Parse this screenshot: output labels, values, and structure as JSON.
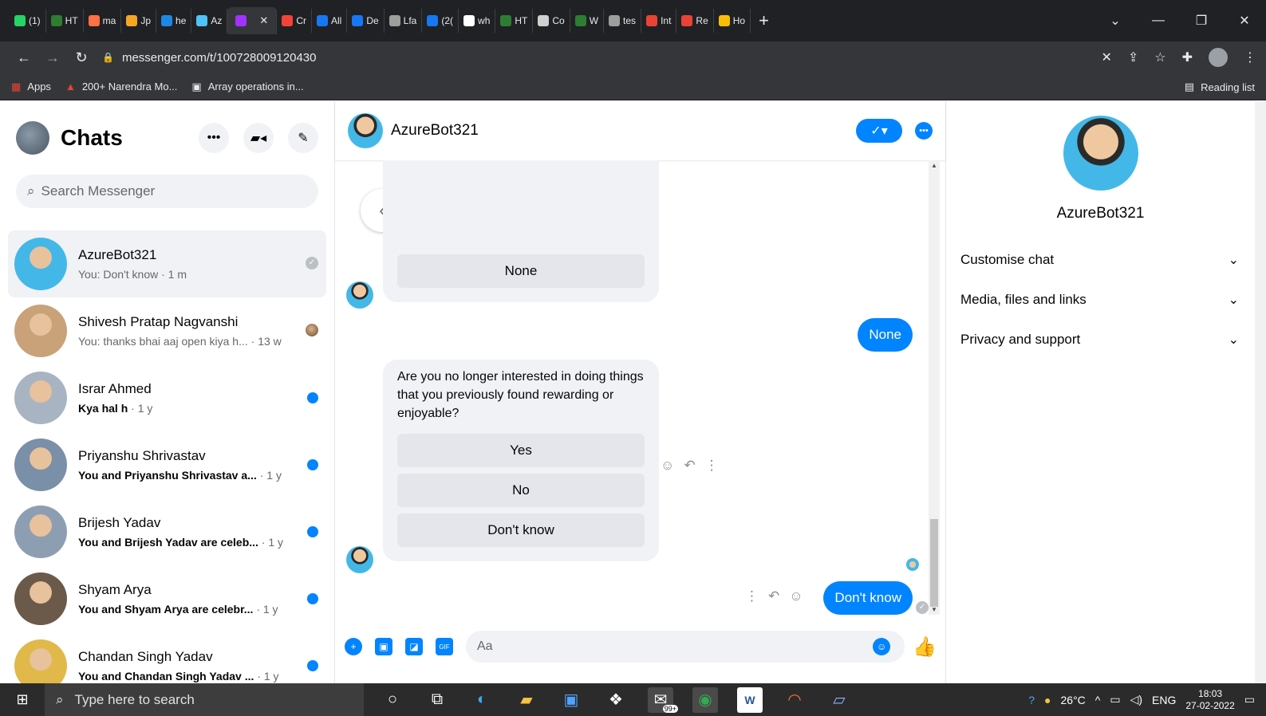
{
  "browser": {
    "tabs": [
      {
        "label": "(1)",
        "color": "#25d366"
      },
      {
        "label": "HT",
        "color": "#2e7d32"
      },
      {
        "label": "ma",
        "color": "#ff7043"
      },
      {
        "label": "Jp",
        "color": "#f5a623"
      },
      {
        "label": "he",
        "color": "#1e88e5"
      },
      {
        "label": "Az",
        "color": "#4fc3f7"
      },
      {
        "label": "",
        "color": "#a033ff",
        "active": true
      },
      {
        "label": "Cr",
        "color": "#f44336"
      },
      {
        "label": "All",
        "color": "#1877f2"
      },
      {
        "label": "De",
        "color": "#1877f2"
      },
      {
        "label": "Lfa",
        "color": "#9e9e9e"
      },
      {
        "label": "(2(",
        "color": "#1877f2"
      },
      {
        "label": "wh",
        "color": "#ffffff"
      },
      {
        "label": "HT",
        "color": "#2e7d32"
      },
      {
        "label": "Co",
        "color": "#cfcfcf"
      },
      {
        "label": "W",
        "color": "#2e7d32"
      },
      {
        "label": "tes",
        "color": "#9e9e9e"
      },
      {
        "label": "Int",
        "color": "#ea4335"
      },
      {
        "label": "Re",
        "color": "#ea4335"
      },
      {
        "label": "Ho",
        "color": "#fbbc04"
      }
    ],
    "new_tab": "+",
    "url": "messenger.com/t/100728009120430",
    "bookmarks": [
      {
        "label": "Apps",
        "icon": "apps-grid-icon"
      },
      {
        "label": "200+ Narendra Mo...",
        "icon": "bookmark-icon"
      },
      {
        "label": "Array operations in...",
        "icon": "bookmark-icon"
      }
    ],
    "reading_list": "Reading list"
  },
  "sidebar": {
    "title": "Chats",
    "search_placeholder": "Search Messenger",
    "chats": [
      {
        "name": "AzureBot321",
        "preview": "You: Don't know",
        "age": " · 1 m",
        "unread": false,
        "status": "seen",
        "avatar_color": "#43b8e8"
      },
      {
        "name": "Shivesh Pratap Nagvanshi",
        "preview": "You: thanks bhai aaj open kiya h...",
        "age": " · 13 w",
        "unread": false,
        "status": "avatar",
        "avatar_color": "#c9a27a"
      },
      {
        "name": "Israr Ahmed",
        "preview": "Kya hal h",
        "age": " · 1 y",
        "unread": true,
        "status": "dot",
        "avatar_color": "#a8b4c2"
      },
      {
        "name": "Priyanshu Shrivastav",
        "preview": "You and Priyanshu Shrivastav a...",
        "age": " · 1 y",
        "unread": true,
        "status": "dot",
        "avatar_color": "#7a8fa8"
      },
      {
        "name": "Brijesh Yadav",
        "preview": "You and Brijesh Yadav are celeb...",
        "age": " · 1 y",
        "unread": true,
        "status": "dot",
        "avatar_color": "#8e9eb2"
      },
      {
        "name": "Shyam Arya",
        "preview": "You and Shyam Arya are celebr...",
        "age": " · 1 y",
        "unread": true,
        "status": "dot",
        "avatar_color": "#6b5a4a"
      },
      {
        "name": "Chandan Singh Yadav",
        "preview": "You and Chandan Singh Yadav ...",
        "age": " · 1 y",
        "unread": true,
        "status": "dot",
        "avatar_color": "#e0b94a"
      }
    ]
  },
  "conversation": {
    "name": "AzureBot321",
    "first_card_option": "None",
    "sent_none": "None",
    "question": "Are you no longer interested in doing things that you previously found rewarding or enjoyable?",
    "options": [
      "Yes",
      "No",
      "Don't know"
    ],
    "sent_last": "Don't know",
    "composer_placeholder": "Aa"
  },
  "info_panel": {
    "name": "AzureBot321",
    "sections": [
      "Customise chat",
      "Media, files and links",
      "Privacy and support"
    ]
  },
  "taskbar": {
    "search_placeholder": "Type here to search",
    "badge": "99+",
    "weather": "26°C",
    "lang": "ENG",
    "time": "18:03",
    "date": "27-02-2022"
  },
  "colors": {
    "messenger_blue": "#0084ff",
    "chrome_dark": "#202124",
    "chrome_toolbar": "#35363a"
  }
}
